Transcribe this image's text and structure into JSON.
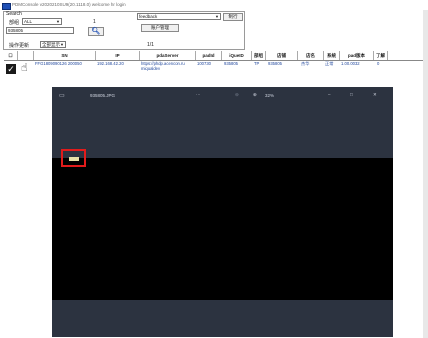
{
  "window": {
    "title": "PDMConsole v2020210SU9(20.1118.0) welcome hr login"
  },
  "search": {
    "group_label": "Search",
    "user_label": "部组",
    "user_select": "ALL",
    "spin_value": "1",
    "id_value": "935805",
    "feedback_select": "feedback",
    "button_next": "制行",
    "button_account": "账户管理",
    "scope_label": "操作更新",
    "scope_select": "全部显示",
    "page_indicator": "1/1"
  },
  "grid": {
    "headers": [
      "SN",
      "IP",
      "pdaServer",
      "padId",
      "iQueID",
      "部组",
      "店铺",
      "店名",
      "系统",
      "pad版本",
      "了解"
    ],
    "row": {
      "sn": "FFG1809090126 200050",
      "ip": "192.168.42.20",
      "pdaserver": "https://phdp.acencon.ru miqualdev",
      "padid": "100730",
      "iqueid": "935805",
      "group": "TP",
      "store": "935805",
      "storename": "杰华",
      "system": "正常",
      "version": "1.00.0032",
      "extra": "0"
    }
  },
  "viewer": {
    "filename": "935805.JPG",
    "dots": "···",
    "zoom": "32%",
    "minimize": "–",
    "maximize": "□",
    "close": "✕"
  },
  "colors": {
    "highlight": "#e21b1b",
    "viewer_chrome": "#2c3340",
    "checkbox": "#1a1a1a"
  }
}
